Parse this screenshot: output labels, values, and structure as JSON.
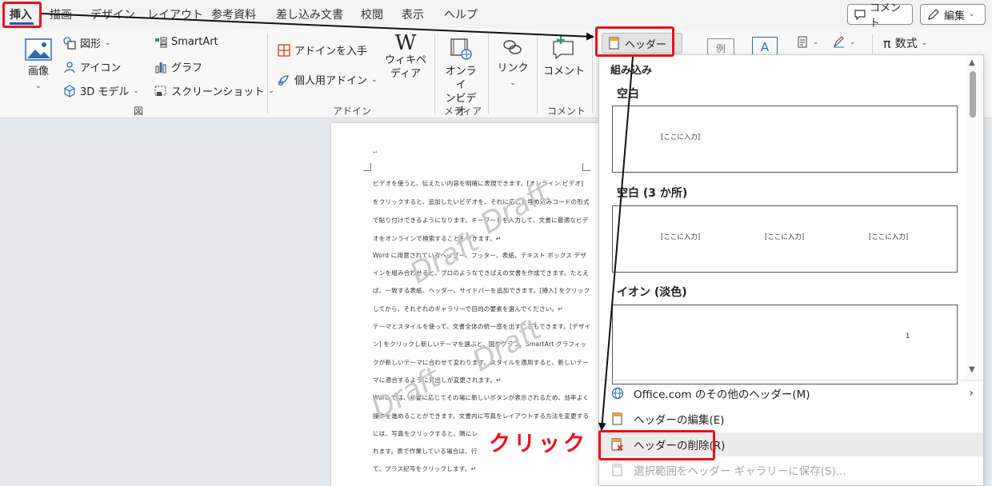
{
  "tabs": [
    "挿入",
    "描画",
    "デザイン",
    "レイアウト",
    "参考資料",
    "差し込み文書",
    "校閲",
    "表示",
    "ヘルプ"
  ],
  "top_buttons": {
    "comment": "コメント",
    "edit": "編集"
  },
  "ribbon": {
    "image": "画像",
    "shapes": "図形",
    "icons": "アイコン",
    "model3d": "3D モデル",
    "smartart": "SmartArt",
    "graph": "グラフ",
    "screenshot": "スクリーンショット",
    "group_figure": "図",
    "get_addins": "アドインを入手",
    "my_addins": "個人用アドイン",
    "wikipedia_l1": "ウィキペ",
    "wikipedia_l2": "ディア",
    "group_addins": "アドイン",
    "online_video_l1": "オンライ",
    "online_video_l2": "ンビデオ",
    "group_media": "メディア",
    "link": "リンク",
    "comment": "コメント",
    "group_comment": "コメント",
    "header_btn": "ヘッダー",
    "example": "例",
    "equation": "数式"
  },
  "document": {
    "lines": [
      "ビデオを使うと、伝えたい内容を明確に表現できます。[オンライン ビデオ]",
      "をクリックすると、追加したいビデオを、それに応じた埋め込みコードの形式",
      "で貼り付けできるようになります。キーワードを入力して、文書に最適なビデ",
      "オをオンラインで検索することもできます。↵",
      "Word に用意されているヘッダー、フッター、表紙、テキスト ボックス デザ",
      "インを組み合わせると、プロのようなできばえの文書を作成できます。たとえ",
      "ば、一致する表紙、ヘッダー、サイドバーを追加できます。[挿入] をクリック",
      "してから、それぞれのギャラリーで目的の要素を選んでください。↵",
      "テーマとスタイルを使って、文書全体の統一感を出すこともできます。[デザイ",
      "ン] をクリックし新しいテーマを選ぶと、図やグラフ、SmartArt グラフィッ",
      "クが新しいテーマに合わせて変わります。スタイルを適用すると、新しいテー",
      "マに適合するように見出しが変更されます。↵",
      "Word では、必要に応じてその場に新しいボタンが表示されるため、効率よく",
      "操作を進めることができます。文書内に写真をレイアウトする方法を変更する",
      "には、写真をクリックすると、隣にレ",
      "れます。表で作業している場合は、行",
      "て、プラス記号をクリックします。↵"
    ],
    "watermark": "Draft",
    "return_mark": "↵"
  },
  "dropdown": {
    "heading": "組み込み",
    "galleries": [
      {
        "title": "空白",
        "placeholders": [
          "[ここに入力]"
        ]
      },
      {
        "title": "空白 (3 か所)",
        "placeholders": [
          "[ここに入力]",
          "[ここに入力]",
          "[ここに入力]"
        ]
      },
      {
        "title": "イオン (淡色)",
        "placeholders": [
          "1"
        ]
      }
    ],
    "menu": [
      {
        "label": "Office.com のその他のヘッダー(M)"
      },
      {
        "label": "ヘッダーの編集(E)"
      },
      {
        "label": "ヘッダーの削除(R)"
      },
      {
        "label": "選択範囲をヘッダー ギャラリーに保存(S)..."
      }
    ]
  },
  "annotation": {
    "click_label": "クリック",
    "color": "#e8111b"
  },
  "colors": {
    "accent": "#185abd",
    "highlight": "#e8111b"
  }
}
